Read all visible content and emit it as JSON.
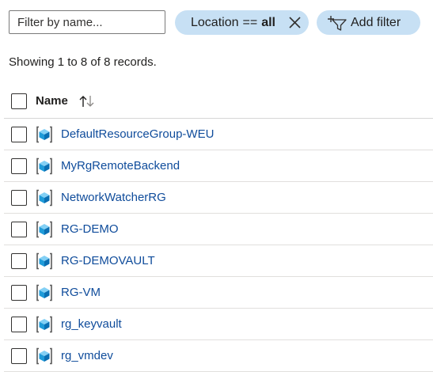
{
  "filter": {
    "search_placeholder": "Filter by name...",
    "location_pill": {
      "key": "Location",
      "operator": "==",
      "value": "all",
      "close_icon": "close-icon"
    },
    "add_filter_label": "Add filter",
    "add_filter_icon": "add-filter-icon"
  },
  "summary": "Showing 1 to 8 of 8 records.",
  "table": {
    "column_name": "Name",
    "sort_icon": "sort-arrows-icon",
    "rows": [
      {
        "name": "DefaultResourceGroup-WEU",
        "icon": "resource-group-icon"
      },
      {
        "name": "MyRgRemoteBackend",
        "icon": "resource-group-icon"
      },
      {
        "name": "NetworkWatcherRG",
        "icon": "resource-group-icon"
      },
      {
        "name": "RG-DEMO",
        "icon": "resource-group-icon"
      },
      {
        "name": "RG-DEMOVAULT",
        "icon": "resource-group-icon"
      },
      {
        "name": "RG-VM",
        "icon": "resource-group-icon"
      },
      {
        "name": "rg_keyvault",
        "icon": "resource-group-icon"
      },
      {
        "name": "rg_vmdev",
        "icon": "resource-group-icon"
      }
    ]
  },
  "colors": {
    "pill_background": "#c7e0f4",
    "link": "#0f4c9b",
    "divider": "#e1dfdd"
  }
}
